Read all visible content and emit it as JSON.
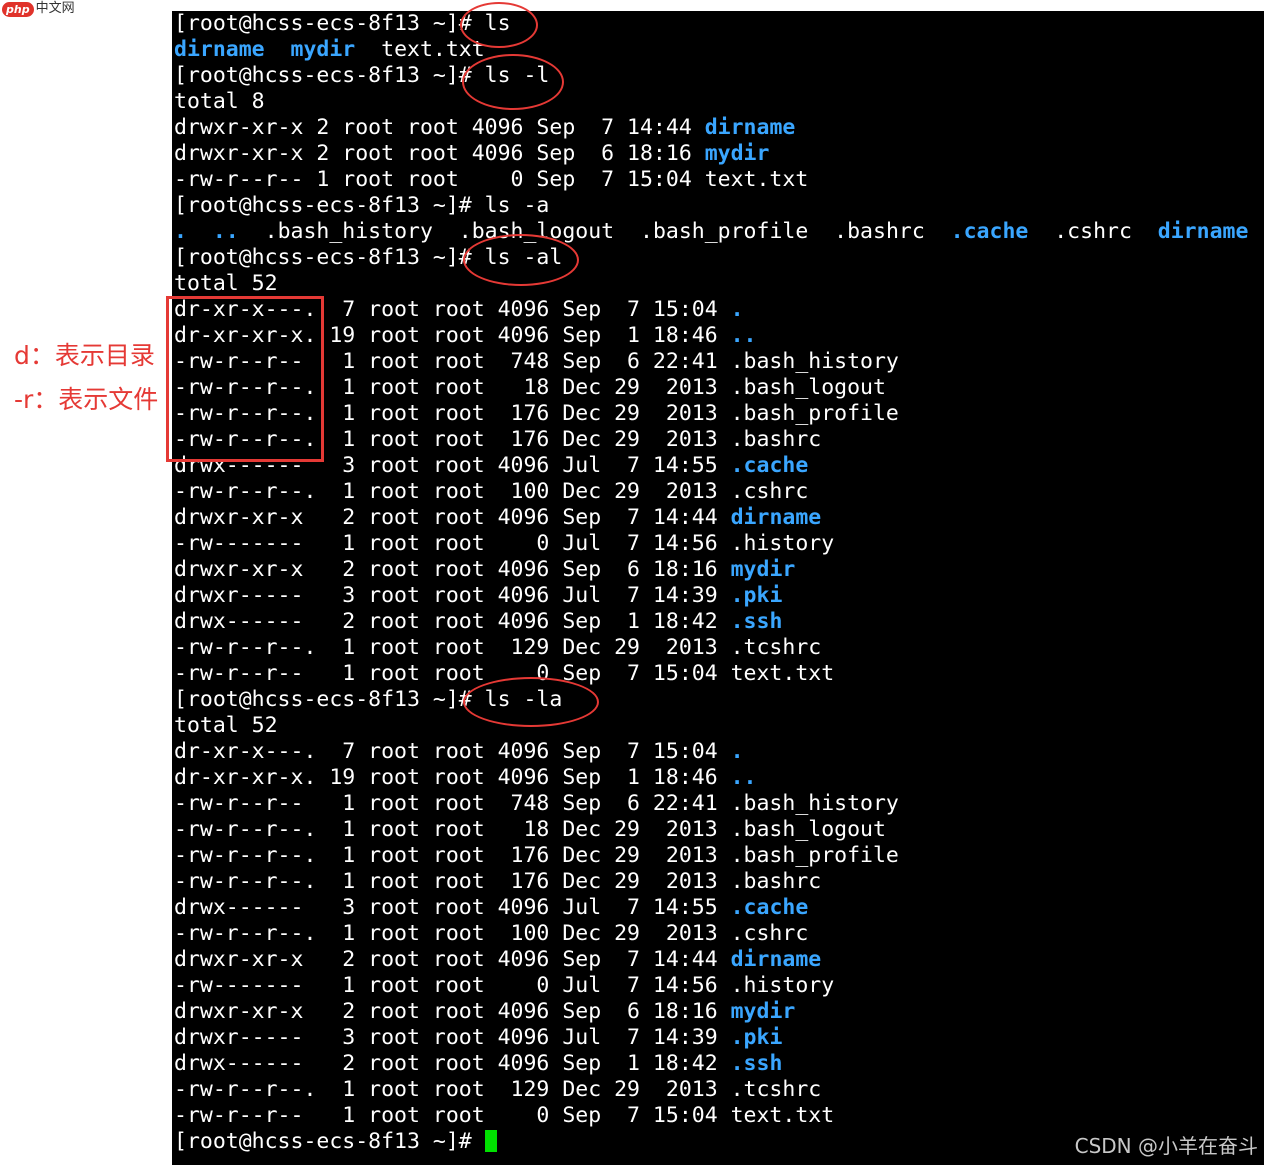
{
  "site_logo": {
    "badge": "php",
    "text": "中文网"
  },
  "annotations": {
    "d_label": "d：表示目录",
    "r_label": "-r：表示文件"
  },
  "watermark": "CSDN @小羊在奋斗",
  "terminal": {
    "lines": [
      [
        {
          "t": "[root@hcss-ecs-8f13 ~]# ls"
        }
      ],
      [
        {
          "t": "dirname",
          "c": "blue"
        },
        {
          "t": "  "
        },
        {
          "t": "mydir",
          "c": "blue"
        },
        {
          "t": "  text.txt"
        }
      ],
      [
        {
          "t": "[root@hcss-ecs-8f13 ~]# ls -l"
        }
      ],
      [
        {
          "t": "total 8"
        }
      ],
      [
        {
          "t": "drwxr-xr-x 2 root root 4096 Sep  7 14:44 "
        },
        {
          "t": "dirname",
          "c": "blue"
        }
      ],
      [
        {
          "t": "drwxr-xr-x 2 root root 4096 Sep  6 18:16 "
        },
        {
          "t": "mydir",
          "c": "blue"
        }
      ],
      [
        {
          "t": "-rw-r--r-- 1 root root    0 Sep  7 15:04 text.txt"
        }
      ],
      [
        {
          "t": "[root@hcss-ecs-8f13 ~]# ls -a"
        }
      ],
      [
        {
          "t": ".",
          "c": "blue"
        },
        {
          "t": "  "
        },
        {
          "t": "..",
          "c": "blue"
        },
        {
          "t": "  .bash_history  .bash_logout  .bash_profile  .bashrc  "
        },
        {
          "t": ".cache",
          "c": "blue"
        },
        {
          "t": "  .cshrc  "
        },
        {
          "t": "dirname",
          "c": "blue"
        }
      ],
      [
        {
          "t": "[root@hcss-ecs-8f13 ~]# ls -al"
        }
      ],
      [
        {
          "t": "total 52"
        }
      ],
      [
        {
          "t": "dr-xr-x---.  7 root root 4096 Sep  7 15:04 "
        },
        {
          "t": ".",
          "c": "blue"
        }
      ],
      [
        {
          "t": "dr-xr-xr-x. 19 root root 4096 Sep  1 18:46 "
        },
        {
          "t": "..",
          "c": "blue"
        }
      ],
      [
        {
          "t": "-rw-r--r--   1 root root  748 Sep  6 22:41 .bash_history"
        }
      ],
      [
        {
          "t": "-rw-r--r--.  1 root root   18 Dec 29  2013 .bash_logout"
        }
      ],
      [
        {
          "t": "-rw-r--r--.  1 root root  176 Dec 29  2013 .bash_profile"
        }
      ],
      [
        {
          "t": "-rw-r--r--.  1 root root  176 Dec 29  2013 .bashrc"
        }
      ],
      [
        {
          "t": "drwx------   3 root root 4096 Jul  7 14:55 "
        },
        {
          "t": ".cache",
          "c": "blue"
        }
      ],
      [
        {
          "t": "-rw-r--r--.  1 root root  100 Dec 29  2013 .cshrc"
        }
      ],
      [
        {
          "t": "drwxr-xr-x   2 root root 4096 Sep  7 14:44 "
        },
        {
          "t": "dirname",
          "c": "blue"
        }
      ],
      [
        {
          "t": "-rw-------   1 root root    0 Jul  7 14:56 .history"
        }
      ],
      [
        {
          "t": "drwxr-xr-x   2 root root 4096 Sep  6 18:16 "
        },
        {
          "t": "mydir",
          "c": "blue"
        }
      ],
      [
        {
          "t": "drwxr-----   3 root root 4096 Jul  7 14:39 "
        },
        {
          "t": ".pki",
          "c": "blue"
        }
      ],
      [
        {
          "t": "drwx------   2 root root 4096 Sep  1 18:42 "
        },
        {
          "t": ".ssh",
          "c": "blue"
        }
      ],
      [
        {
          "t": "-rw-r--r--.  1 root root  129 Dec 29  2013 .tcshrc"
        }
      ],
      [
        {
          "t": "-rw-r--r--   1 root root    0 Sep  7 15:04 text.txt"
        }
      ],
      [
        {
          "t": "[root@hcss-ecs-8f13 ~]# ls -la"
        }
      ],
      [
        {
          "t": "total 52"
        }
      ],
      [
        {
          "t": "dr-xr-x---.  7 root root 4096 Sep  7 15:04 "
        },
        {
          "t": ".",
          "c": "blue"
        }
      ],
      [
        {
          "t": "dr-xr-xr-x. 19 root root 4096 Sep  1 18:46 "
        },
        {
          "t": "..",
          "c": "blue"
        }
      ],
      [
        {
          "t": "-rw-r--r--   1 root root  748 Sep  6 22:41 .bash_history"
        }
      ],
      [
        {
          "t": "-rw-r--r--.  1 root root   18 Dec 29  2013 .bash_logout"
        }
      ],
      [
        {
          "t": "-rw-r--r--.  1 root root  176 Dec 29  2013 .bash_profile"
        }
      ],
      [
        {
          "t": "-rw-r--r--.  1 root root  176 Dec 29  2013 .bashrc"
        }
      ],
      [
        {
          "t": "drwx------   3 root root 4096 Jul  7 14:55 "
        },
        {
          "t": ".cache",
          "c": "blue"
        }
      ],
      [
        {
          "t": "-rw-r--r--.  1 root root  100 Dec 29  2013 .cshrc"
        }
      ],
      [
        {
          "t": "drwxr-xr-x   2 root root 4096 Sep  7 14:44 "
        },
        {
          "t": "dirname",
          "c": "blue"
        }
      ],
      [
        {
          "t": "-rw-------   1 root root    0 Jul  7 14:56 .history"
        }
      ],
      [
        {
          "t": "drwxr-xr-x   2 root root 4096 Sep  6 18:16 "
        },
        {
          "t": "mydir",
          "c": "blue"
        }
      ],
      [
        {
          "t": "drwxr-----   3 root root 4096 Jul  7 14:39 "
        },
        {
          "t": ".pki",
          "c": "blue"
        }
      ],
      [
        {
          "t": "drwx------   2 root root 4096 Sep  1 18:42 "
        },
        {
          "t": ".ssh",
          "c": "blue"
        }
      ],
      [
        {
          "t": "-rw-r--r--.  1 root root  129 Dec 29  2013 .tcshrc"
        }
      ],
      [
        {
          "t": "-rw-r--r--   1 root root    0 Sep  7 15:04 text.txt"
        }
      ],
      [
        {
          "t": "[root@hcss-ecs-8f13 ~]# "
        }
      ]
    ]
  },
  "colors": {
    "terminal_bg": "#000000",
    "text": "#ffffff",
    "directory": "#3aa6ff",
    "annotation": "#e53935",
    "cursor": "#00e000"
  }
}
